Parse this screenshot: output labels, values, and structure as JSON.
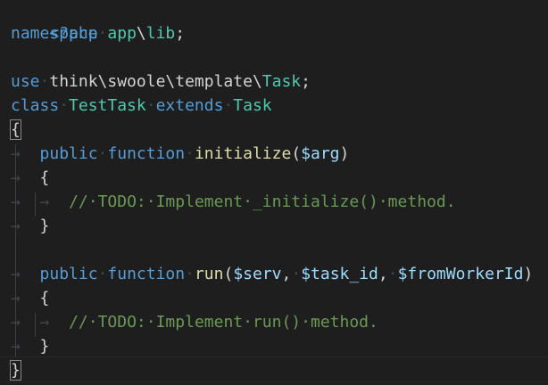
{
  "editor": {
    "lines": [
      {
        "t": "<?php"
      },
      {
        "t": "namespace app\\lib;"
      },
      {
        "t": ""
      },
      {
        "t": "use think\\swoole\\template\\Task;"
      },
      {
        "t": "class TestTask extends Task"
      },
      {
        "t": "{"
      },
      {
        "t": "    public function initialize($arg)"
      },
      {
        "t": "    {"
      },
      {
        "t": "        // TODO: Implement _initialize() method."
      },
      {
        "t": "    }"
      },
      {
        "t": ""
      },
      {
        "t": "    public function run($serv, $task_id, $fromWorkerId)"
      },
      {
        "t": "    {"
      },
      {
        "t": "        // TODO: Implement run() method."
      },
      {
        "t": "    }"
      },
      {
        "t": "}"
      }
    ],
    "colors": {
      "background": "#1e1e1e",
      "keyword": "#569cd6",
      "class": "#4ec9b0",
      "function": "#dcdcaa",
      "variable": "#9cdcfe",
      "comment": "#6a9955",
      "text": "#d4d4d4"
    }
  }
}
